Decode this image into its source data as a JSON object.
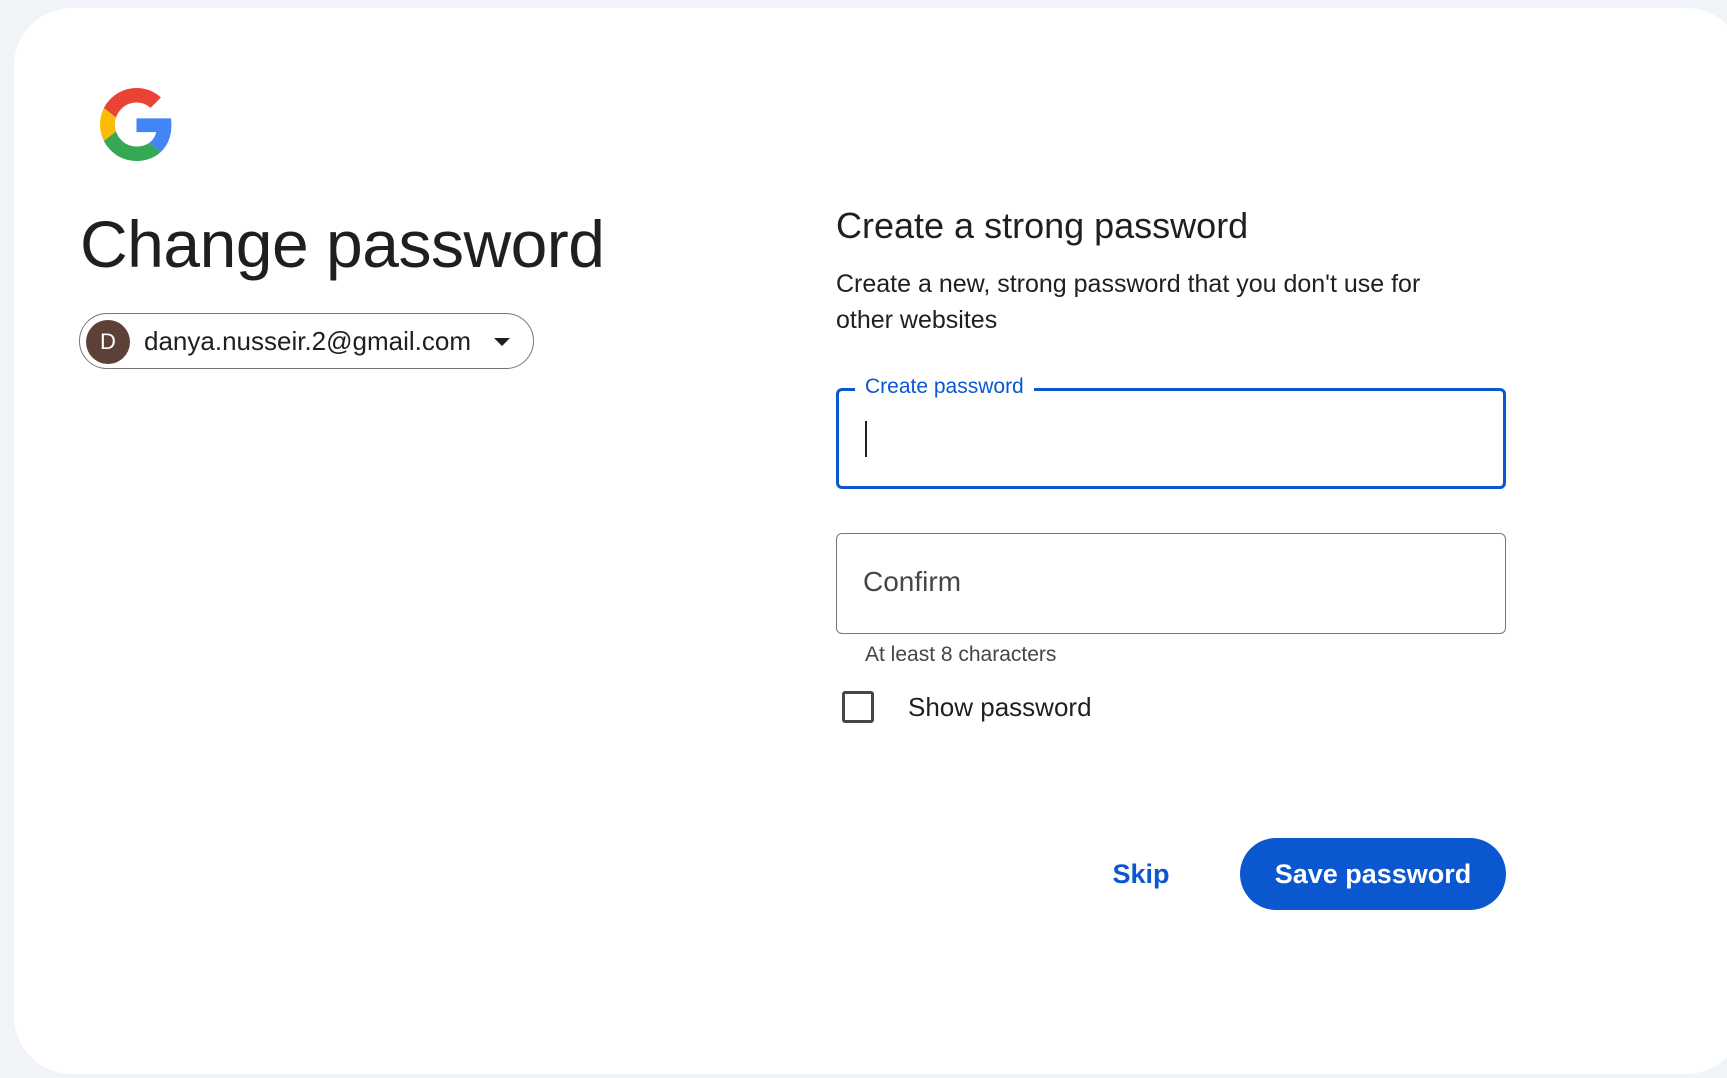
{
  "header": {
    "logo_icon": "google-g-icon",
    "title": "Change password"
  },
  "account": {
    "avatar_initial": "D",
    "avatar_color": "#5d4037",
    "email": "danya.nusseir.2@gmail.com",
    "dropdown_icon": "chevron-down-icon"
  },
  "form": {
    "heading": "Create a strong password",
    "description": "Create a new, strong password that you don't use for other websites",
    "create_password": {
      "label": "Create password",
      "value": "",
      "focused": true
    },
    "confirm_password": {
      "placeholder": "Confirm",
      "value": ""
    },
    "hint": "At least 8 characters",
    "show_password": {
      "label": "Show password",
      "checked": false
    }
  },
  "actions": {
    "skip_label": "Skip",
    "save_label": "Save password"
  },
  "colors": {
    "accent": "#0b57d0",
    "page_background": "#f0f4f9",
    "card_background": "#ffffff",
    "text": "#1f1f1f"
  }
}
